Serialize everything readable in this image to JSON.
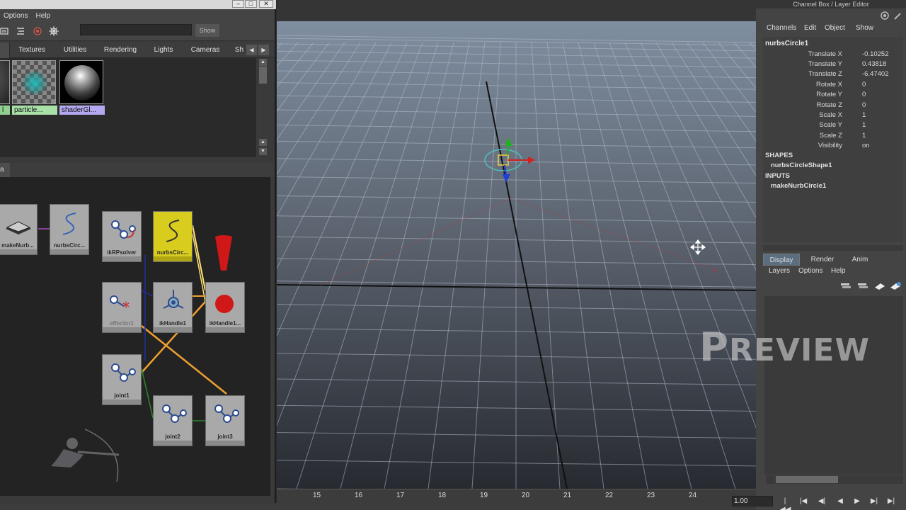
{
  "hypershade": {
    "menu": [
      "Options",
      "Help"
    ],
    "show_label": "Show",
    "tabs": [
      "Textures",
      "Utilities",
      "Rendering",
      "Lights",
      "Cameras",
      "Sh"
    ],
    "swatches": [
      {
        "label": "l",
        "label_bg": "#8fd28f"
      },
      {
        "label": "particle...",
        "label_bg": "#a8e0a8"
      },
      {
        "label": "shaderGl...",
        "label_bg": "#b4a8f0"
      }
    ],
    "work_tab": "a",
    "nodes": [
      {
        "id": "makeNurb",
        "label": "makeNurb..."
      },
      {
        "id": "nurbsCirc1",
        "label": "nurbsCirc..."
      },
      {
        "id": "ikRPsolver",
        "label": "ikRPsolver"
      },
      {
        "id": "nurbsCirc2",
        "label": "nurbsCirc..."
      },
      {
        "id": "effector1",
        "label": "effector1"
      },
      {
        "id": "ikHandle1",
        "label": "ikHandle1"
      },
      {
        "id": "ikHandle1b",
        "label": "ikHandle1..."
      },
      {
        "id": "joint1",
        "label": "joint1"
      },
      {
        "id": "joint2",
        "label": "joint2"
      },
      {
        "id": "joint3",
        "label": "joint3"
      }
    ]
  },
  "channel_box": {
    "title": "Channel Box / Layer Editor",
    "menu": [
      "Channels",
      "Edit",
      "Object",
      "Show"
    ],
    "object": "nurbsCircle1",
    "attributes": [
      {
        "name": "Translate X",
        "value": "-0.10252"
      },
      {
        "name": "Translate Y",
        "value": "0.43818"
      },
      {
        "name": "Translate Z",
        "value": "-6.47402"
      },
      {
        "name": "Rotate X",
        "value": "0"
      },
      {
        "name": "Rotate Y",
        "value": "0"
      },
      {
        "name": "Rotate Z",
        "value": "0"
      },
      {
        "name": "Scale X",
        "value": "1"
      },
      {
        "name": "Scale Y",
        "value": "1"
      },
      {
        "name": "Scale Z",
        "value": "1"
      },
      {
        "name": "Visibility",
        "value": "on"
      }
    ],
    "shapes_header": "SHAPES",
    "shape": "nurbsCircleShape1",
    "inputs_header": "INPUTS",
    "input": "makeNurbCircle1"
  },
  "layer_editor": {
    "tabs": [
      "Display",
      "Render",
      "Anim"
    ],
    "active_tab": "Display",
    "menu": [
      "Layers",
      "Options",
      "Help"
    ]
  },
  "timeline": {
    "frames": [
      "15",
      "16",
      "17",
      "18",
      "19",
      "20",
      "21",
      "22",
      "23",
      "24"
    ],
    "current_value": "1.00"
  },
  "watermark": {
    "first": "P",
    "rest": "REVIEW"
  },
  "colors": {
    "yellow_node": "#d8cd1e",
    "active_tab": "#5a6e80",
    "connection_orange": "#f0a030",
    "connection_yellow": "#ffe070"
  }
}
